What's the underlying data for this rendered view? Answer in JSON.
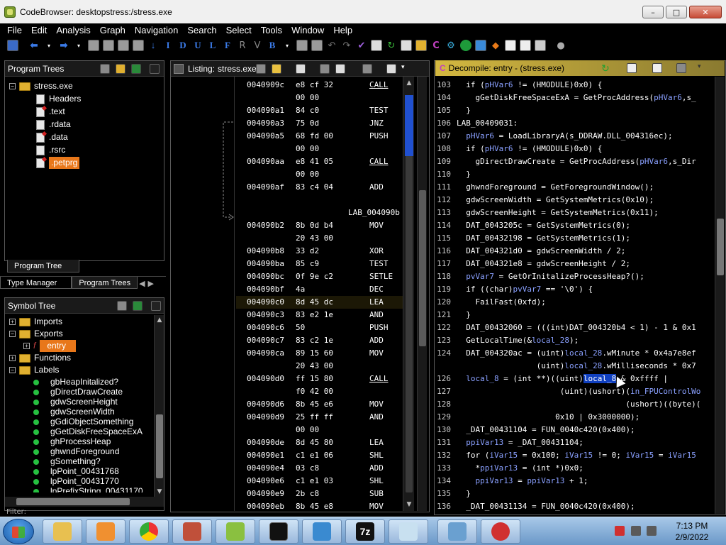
{
  "window": {
    "title": "CodeBrowser: desktopstress:/stress.exe",
    "buttons": [
      "–",
      "□",
      "✕"
    ]
  },
  "menu": [
    "File",
    "Edit",
    "Analysis",
    "Graph",
    "Navigation",
    "Search",
    "Select",
    "Tools",
    "Window",
    "Help"
  ],
  "toolbar": {
    "letters": [
      "I",
      "D",
      "U",
      "L",
      "F",
      "V",
      "B"
    ]
  },
  "program_trees": {
    "title": "Program Trees",
    "root": "stress.exe",
    "items": [
      "Headers",
      ".text",
      ".rdata",
      ".data",
      ".rsrc",
      ".petprg"
    ],
    "tabs": [
      "Program Tree"
    ]
  },
  "bottom_tabs": [
    "Type Manager",
    "Program Trees"
  ],
  "symbol_tree": {
    "title": "Symbol Tree",
    "nodes": [
      "Imports",
      "Exports",
      "entry",
      "Functions",
      "Labels"
    ],
    "labels": [
      "gbHeapInitalized?",
      "gDirectDrawCreate",
      "gdwScreenHeight",
      "gdwScreenWidth",
      "gGdiObjectSomething",
      "gGetDiskFreeSpaceExA",
      "ghProcessHeap",
      "ghwndForeground",
      "gSomething?",
      "lpPoint_00431768",
      "lpPoint_00431770",
      "lpPrefixString_00431170"
    ],
    "filter_label": "Filter:"
  },
  "listing": {
    "title": "Listing:",
    "file": "stress.exe",
    "rows": [
      {
        "addr": "0040909c",
        "bytes": "e8 cf 32",
        "mn": "CALL"
      },
      {
        "addr": "",
        "bytes": "00 00",
        "mn": ""
      },
      {
        "addr": "004090a1",
        "bytes": "84 c0",
        "mn": "TEST"
      },
      {
        "addr": "004090a3",
        "bytes": "75 0d",
        "mn": "JNZ"
      },
      {
        "addr": "004090a5",
        "bytes": "68 fd 00",
        "mn": "PUSH"
      },
      {
        "addr": "",
        "bytes": "00 00",
        "mn": ""
      },
      {
        "addr": "004090aa",
        "bytes": "e8 41 05",
        "mn": "CALL"
      },
      {
        "addr": "",
        "bytes": "00 00",
        "mn": ""
      },
      {
        "addr": "004090af",
        "bytes": "83 c4 04",
        "mn": "ADD"
      },
      {
        "addr": "",
        "bytes": "",
        "mn": ""
      },
      {
        "addr": "",
        "bytes": "",
        "mn": "",
        "label": "LAB_004090b"
      },
      {
        "addr": "004090b2",
        "bytes": "8b 0d b4",
        "mn": "MOV"
      },
      {
        "addr": "",
        "bytes": "20 43 00",
        "mn": ""
      },
      {
        "addr": "004090b8",
        "bytes": "33 d2",
        "mn": "XOR"
      },
      {
        "addr": "004090ba",
        "bytes": "85 c9",
        "mn": "TEST"
      },
      {
        "addr": "004090bc",
        "bytes": "0f 9e c2",
        "mn": "SETLE"
      },
      {
        "addr": "004090bf",
        "bytes": "4a",
        "mn": "DEC"
      },
      {
        "addr": "004090c0",
        "bytes": "8d 45 dc",
        "mn": "LEA"
      },
      {
        "addr": "004090c3",
        "bytes": "83 e2 1e",
        "mn": "AND"
      },
      {
        "addr": "004090c6",
        "bytes": "50",
        "mn": "PUSH"
      },
      {
        "addr": "004090c7",
        "bytes": "83 c2 1e",
        "mn": "ADD"
      },
      {
        "addr": "004090ca",
        "bytes": "89 15 60",
        "mn": "MOV"
      },
      {
        "addr": "",
        "bytes": "20 43 00",
        "mn": ""
      },
      {
        "addr": "004090d0",
        "bytes": "ff 15 80",
        "mn": "CALL"
      },
      {
        "addr": "",
        "bytes": "f0 42 00",
        "mn": ""
      },
      {
        "addr": "004090d6",
        "bytes": "8b 45 e6",
        "mn": "MOV"
      },
      {
        "addr": "004090d9",
        "bytes": "25 ff ff",
        "mn": "AND"
      },
      {
        "addr": "",
        "bytes": "00 00",
        "mn": ""
      },
      {
        "addr": "004090de",
        "bytes": "8d 45 80",
        "mn": "LEA"
      },
      {
        "addr": "004090e1",
        "bytes": "c1 e1 06",
        "mn": "SHL"
      },
      {
        "addr": "004090e4",
        "bytes": "03 c8",
        "mn": "ADD"
      },
      {
        "addr": "004090e6",
        "bytes": "c1 e1 03",
        "mn": "SHL"
      },
      {
        "addr": "004090e9",
        "bytes": "2b c8",
        "mn": "SUB"
      },
      {
        "addr": "004090eb",
        "bytes": "8b 45 e8",
        "mn": "MOV"
      }
    ]
  },
  "decompile": {
    "title": "Decompile: entry - (stress.exe)",
    "lines": [
      {
        "n": "103",
        "t": "  if (pHVar6 != (HMODULE)0x0) {"
      },
      {
        "n": "104",
        "t": "    gGetDiskFreeSpaceExA = GetProcAddress(pHVar6,s_"
      },
      {
        "n": "105",
        "t": "  }"
      },
      {
        "n": "106",
        "t": "LAB_00409031:"
      },
      {
        "n": "107",
        "t": "  pHVar6 = LoadLibraryA(s_DDRAW.DLL_004316ec);"
      },
      {
        "n": "108",
        "t": "  if (pHVar6 != (HMODULE)0x0) {"
      },
      {
        "n": "109",
        "t": "    gDirectDrawCreate = GetProcAddress(pHVar6,s_Dir"
      },
      {
        "n": "110",
        "t": "  }"
      },
      {
        "n": "111",
        "t": "  ghwndForeground = GetForegroundWindow();"
      },
      {
        "n": "112",
        "t": "  gdwScreenWidth = GetSystemMetrics(0x10);"
      },
      {
        "n": "113",
        "t": "  gdwScreenHeight = GetSystemMetrics(0x11);"
      },
      {
        "n": "114",
        "t": "  DAT_0043205c = GetSystemMetrics(0);"
      },
      {
        "n": "115",
        "t": "  DAT_00432198 = GetSystemMetrics(1);"
      },
      {
        "n": "116",
        "t": "  DAT_004321d0 = gdwScreenWidth / 2;"
      },
      {
        "n": "117",
        "t": "  DAT_004321e8 = gdwScreenHeight / 2;"
      },
      {
        "n": "118",
        "t": "  pvVar7 = GetOrInitalizeProcessHeap?();"
      },
      {
        "n": "119",
        "t": "  if ((char)pvVar7 == '\\0') {"
      },
      {
        "n": "120",
        "t": "    FailFast(0xfd);"
      },
      {
        "n": "121",
        "t": "  }"
      },
      {
        "n": "122",
        "t": "  DAT_00432060 = (((int)DAT_004320b4 < 1) - 1 & 0x1"
      },
      {
        "n": "123",
        "t": "  GetLocalTime(&local_28);"
      },
      {
        "n": "124",
        "t": "  DAT_004320ac = (uint)local_28.wMinute * 0x4a7e8ef"
      },
      {
        "n": "",
        "t": "                 (uint)local_28.wMilliseconds * 0x7"
      },
      {
        "n": "126",
        "t": "  local_8 = (int **)((uint)local_8 & 0xffff |"
      },
      {
        "n": "127",
        "t": "                      (uint)(ushort)(in_FPUControlWo"
      },
      {
        "n": "128",
        "t": "                                    (ushort)((byte)("
      },
      {
        "n": "129",
        "t": "                     0x10 | 0x3000000);"
      },
      {
        "n": "130",
        "t": "  _DAT_00431104 = FUN_0040c420(0x400);"
      },
      {
        "n": "131",
        "t": "  ppiVar13 = _DAT_00431104;"
      },
      {
        "n": "132",
        "t": "  for (iVar15 = 0x100; iVar15 != 0; iVar15 = iVar15"
      },
      {
        "n": "133",
        "t": "    *ppiVar13 = (int *)0x0;"
      },
      {
        "n": "134",
        "t": "    ppiVar13 = ppiVar13 + 1;"
      },
      {
        "n": "135",
        "t": "  }"
      },
      {
        "n": "136",
        "t": "  _DAT_00431134 = FUN_0040c420(0x400);"
      }
    ]
  },
  "taskbar": {
    "time": "7:13 PM",
    "date": "2/9/2022",
    "apps": [
      "explorer",
      "media",
      "chrome",
      "ghidra",
      "notepad",
      "cmd",
      "network",
      "7z",
      "notes",
      "remote",
      "ida"
    ],
    "app_label_7z": "7z"
  }
}
